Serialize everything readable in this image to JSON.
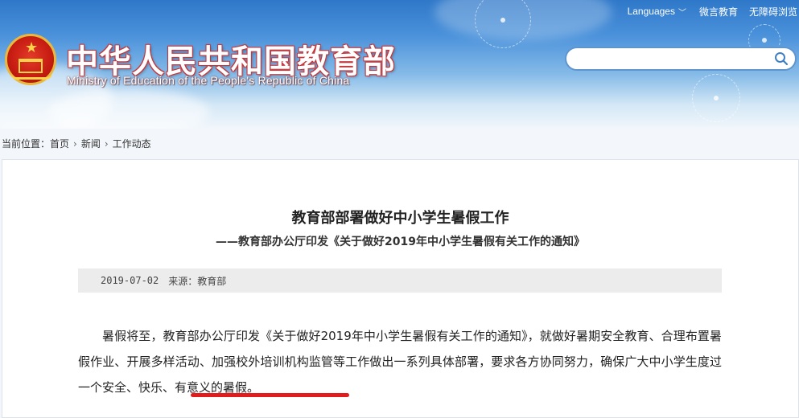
{
  "header": {
    "title": "中华人民共和国教育部",
    "subtitle": "Ministry of Education of the People's Republic of China",
    "top_links": {
      "languages": "Languages",
      "weiyan": "微言教育",
      "accessibility": "无障碍浏览"
    },
    "search": {
      "value": "",
      "placeholder": ""
    }
  },
  "breadcrumb": {
    "prefix": "当前位置：",
    "items": [
      "首页",
      "新闻",
      "工作动态"
    ]
  },
  "article": {
    "title": "教育部部署做好中小学生暑假工作",
    "subtitle": "——教育部办公厅印发《关于做好2019年中小学生暑假有关工作的通知》",
    "date": "2019-07-02",
    "source": "来源：教育部",
    "paragraph": "暑假将至，教育部办公厅印发《关于做好2019年中小学生暑假有关工作的通知》，就做好暑期安全教育、合理布置暑假作业、开展多样活动、加强校外培训机构监管等工作做出一系列具体部署，要求各方协同努力，确保广大中小学生度过一个安全、快乐、有意义的暑假。"
  },
  "colors": {
    "header_blue": "#2f78c9",
    "title_outline": "#c7363a",
    "underline_red": "#e21c1c"
  },
  "icons": [
    "national-emblem-icon",
    "chevron-down-icon",
    "search-icon"
  ]
}
